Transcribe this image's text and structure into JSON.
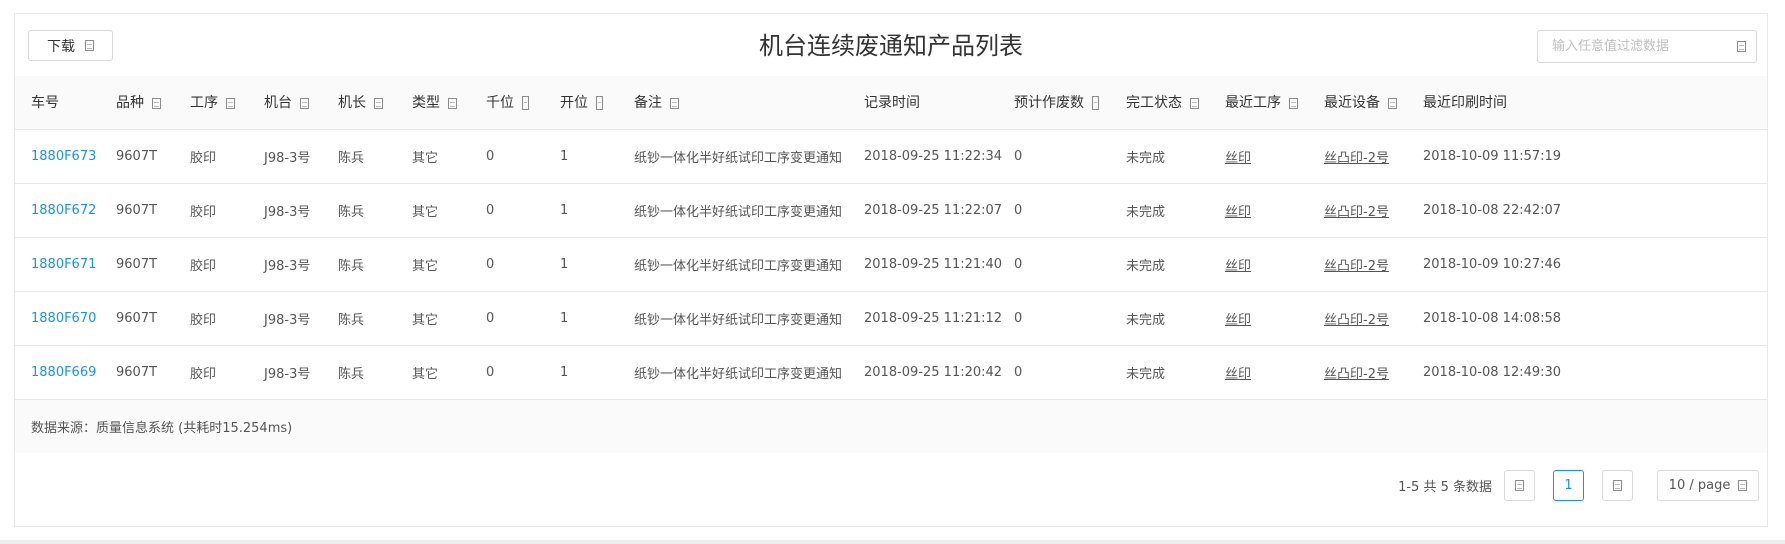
{
  "toolbar": {
    "download_label": "下载"
  },
  "page_title": "机台连续废通知产品列表",
  "search": {
    "placeholder": "输入任意值过滤数据",
    "value": ""
  },
  "table": {
    "columns": [
      "车号",
      "品种",
      "工序",
      "机台",
      "机长",
      "类型",
      "千位",
      "开位",
      "备注",
      "记录时间",
      "预计作废数",
      "完工状态",
      "最近工序",
      "最近设备",
      "最近印刷时间"
    ],
    "rows": [
      [
        "1880F673",
        "9607T",
        "胶印",
        "J98-3号",
        "陈兵",
        "其它",
        "0",
        "1",
        "纸钞一体化半好纸试印工序变更通知",
        "2018-09-25 11:22:34",
        "0",
        "未完成",
        "丝印",
        "丝凸印-2号",
        "2018-10-09 11:57:19"
      ],
      [
        "1880F672",
        "9607T",
        "胶印",
        "J98-3号",
        "陈兵",
        "其它",
        "0",
        "1",
        "纸钞一体化半好纸试印工序变更通知",
        "2018-09-25 11:22:07",
        "0",
        "未完成",
        "丝印",
        "丝凸印-2号",
        "2018-10-08 22:42:07"
      ],
      [
        "1880F671",
        "9607T",
        "胶印",
        "J98-3号",
        "陈兵",
        "其它",
        "0",
        "1",
        "纸钞一体化半好纸试印工序变更通知",
        "2018-09-25 11:21:40",
        "0",
        "未完成",
        "丝印",
        "丝凸印-2号",
        "2018-10-09 10:27:46"
      ],
      [
        "1880F670",
        "9607T",
        "胶印",
        "J98-3号",
        "陈兵",
        "其它",
        "0",
        "1",
        "纸钞一体化半好纸试印工序变更通知",
        "2018-09-25 11:21:12",
        "0",
        "未完成",
        "丝印",
        "丝凸印-2号",
        "2018-10-08 14:08:58"
      ],
      [
        "1880F669",
        "9607T",
        "胶印",
        "J98-3号",
        "陈兵",
        "其它",
        "0",
        "1",
        "纸钞一体化半好纸试印工序变更通知",
        "2018-09-25 11:20:42",
        "0",
        "未完成",
        "丝印",
        "丝凸印-2号",
        "2018-10-08 12:49:30"
      ]
    ],
    "footer": "数据来源：质量信息系统 (共耗时15.254ms)"
  },
  "pagination": {
    "total_text": "1-5 共 5 条数据",
    "current_page": "1",
    "page_size": "10 / page"
  },
  "colors": {
    "link": "#1890ff",
    "border": "#e8e8e8",
    "header_bg": "#fafafa"
  }
}
